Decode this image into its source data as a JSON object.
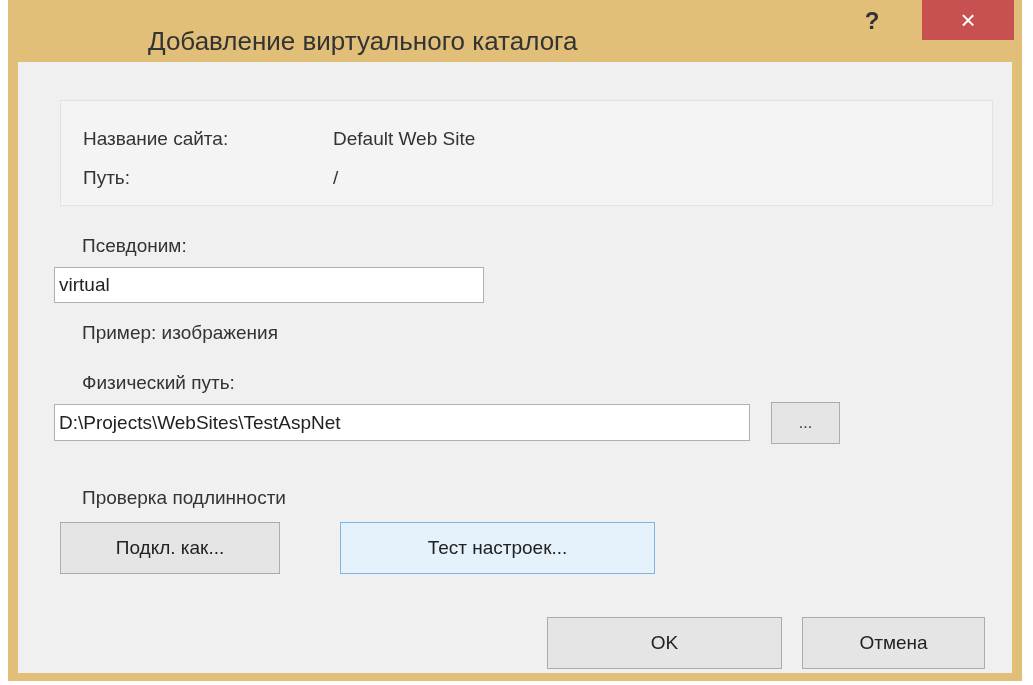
{
  "window": {
    "title": "Добавление виртуального каталога",
    "help_button": "?",
    "close_button": "×"
  },
  "site_info": [
    {
      "label": "Название сайта:",
      "value": "Default Web Site"
    },
    {
      "label": "Путь:",
      "value": "/"
    }
  ],
  "alias": {
    "label": "Псевдоним:",
    "value": "virtual",
    "example": "Пример: изображения"
  },
  "physical_path": {
    "label": "Физический путь:",
    "value": "D:\\Projects\\WebSites\\TestAspNet",
    "browse_button": "..."
  },
  "authentication": {
    "label": "Проверка подлинности",
    "buttons": [
      {
        "label": "Подкл. как...",
        "focused": false
      },
      {
        "label": "Тест настроек...",
        "focused": true
      }
    ]
  },
  "buttons": [
    {
      "label": "OK",
      "focused": false
    },
    {
      "label": "Отмена",
      "focused": false
    }
  ]
}
